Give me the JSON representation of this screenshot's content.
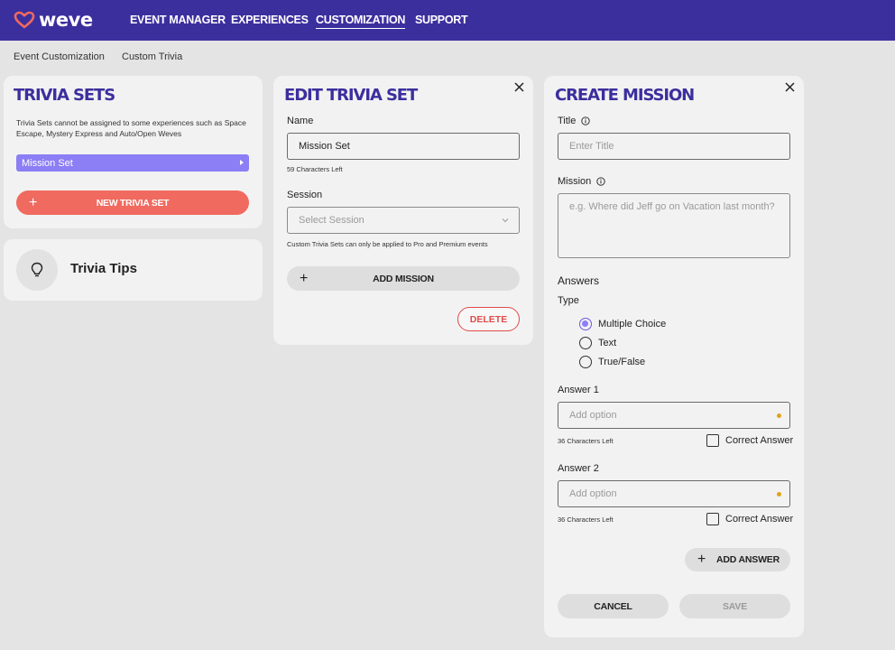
{
  "header": {
    "logo_text": "weve",
    "nav": [
      "EVENT MANAGER",
      "EXPERIENCES",
      "CUSTOMIZATION",
      "SUPPORT"
    ],
    "active_nav": "CUSTOMIZATION"
  },
  "breadcrumb": [
    "Event Customization",
    "Custom Trivia"
  ],
  "trivia_sets": {
    "title": "TRIVIA SETS",
    "note": "Trivia Sets cannot be assigned to some experiences such as Space Escape, Mystery Express and Auto/Open Weves",
    "items": [
      "Mission Set"
    ],
    "new_button": "NEW TRIVIA SET"
  },
  "tips": {
    "label": "Trivia Tips",
    "icon": "lightbulb-icon"
  },
  "edit_set": {
    "title": "EDIT TRIVIA SET",
    "name_label": "Name",
    "name_value": "Mission Set",
    "name_hint": "59 Characters Left",
    "session_label": "Session",
    "session_placeholder": "Select Session",
    "session_note": "Custom Trivia Sets can only be applied to Pro and Premium events",
    "add_mission": "ADD MISSION",
    "delete": "DELETE"
  },
  "create_mission": {
    "title": "CREATE MISSION",
    "title_label": "Title",
    "title_placeholder": "Enter Title",
    "mission_label": "Mission",
    "mission_placeholder": "e.g. Where did Jeff go on Vacation last month?",
    "answers_label": "Answers",
    "type_label": "Type",
    "types": [
      "Multiple Choice",
      "Text",
      "True/False"
    ],
    "selected_type": "Multiple Choice",
    "answers": [
      {
        "label": "Answer 1",
        "placeholder": "Add option",
        "hint": "36 Characters Left",
        "correct_label": "Correct Answer"
      },
      {
        "label": "Answer 2",
        "placeholder": "Add option",
        "hint": "36 Characters Left",
        "correct_label": "Correct Answer"
      }
    ],
    "add_answer": "ADD ANSWER",
    "cancel": "CANCEL",
    "save": "SAVE"
  },
  "colors": {
    "brand": "#3b2f9e",
    "accent_coral": "#f06a5f",
    "accent_purple": "#8c7ef5",
    "danger": "#e24b4b",
    "required_dot": "#e2a21b"
  }
}
